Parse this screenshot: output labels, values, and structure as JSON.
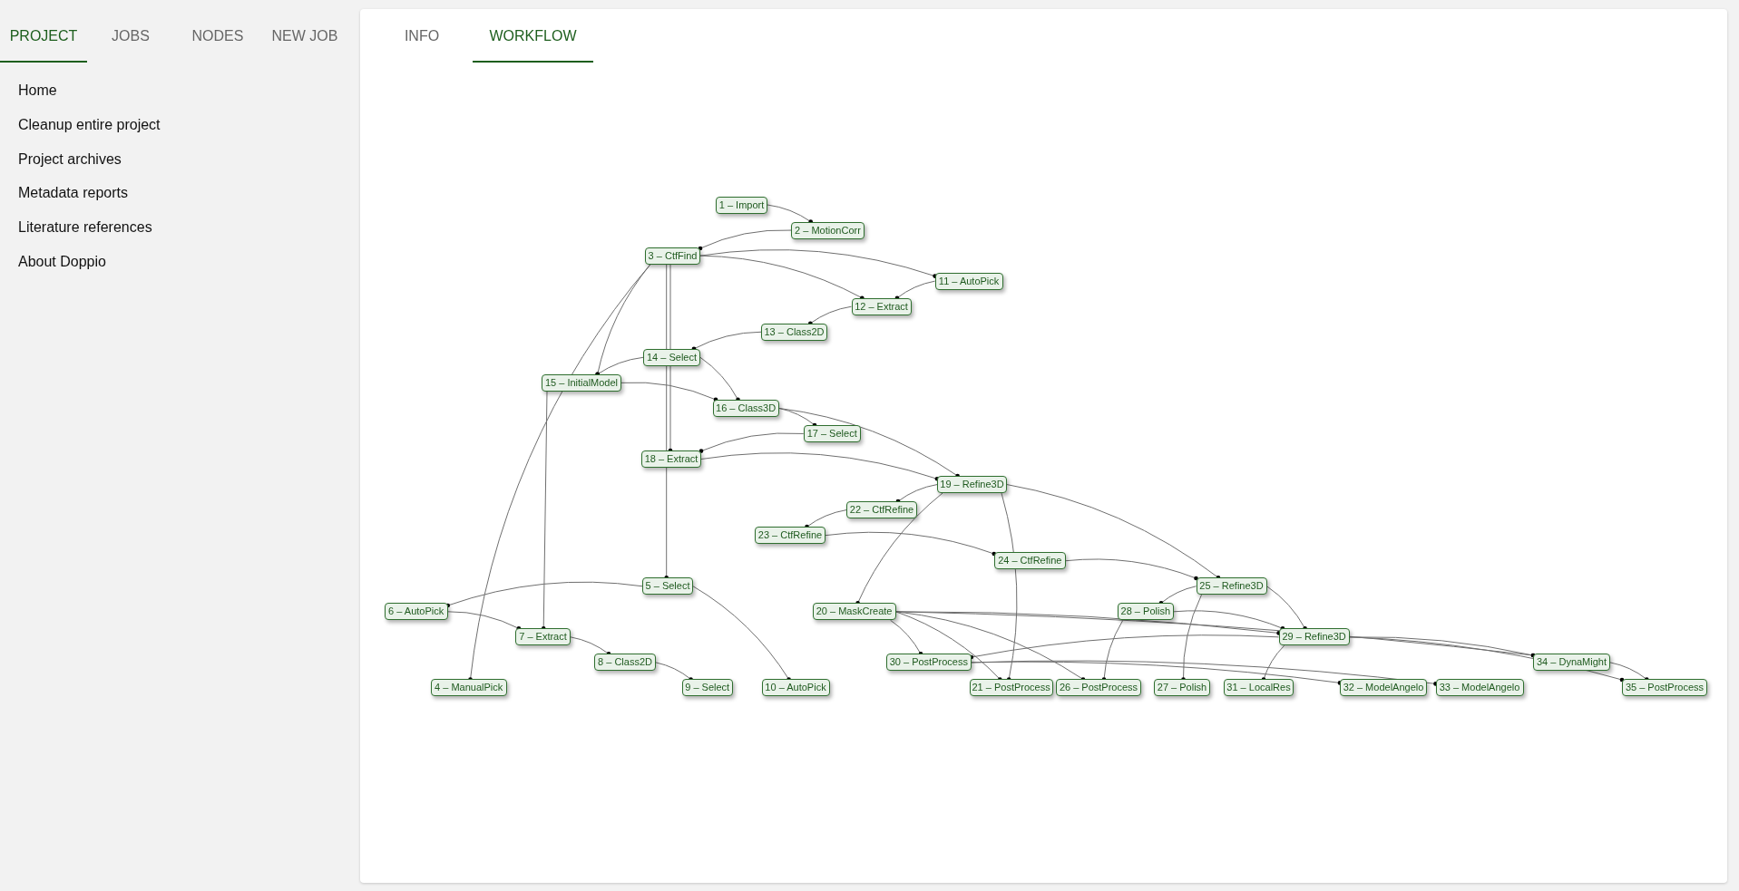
{
  "sidebar": {
    "tabs": [
      {
        "label": "PROJECT",
        "selected": true
      },
      {
        "label": "JOBS",
        "selected": false
      },
      {
        "label": "NODES",
        "selected": false
      },
      {
        "label": "NEW JOB",
        "selected": false
      }
    ],
    "menu": [
      "Home",
      "Cleanup entire project",
      "Project archives",
      "Metadata reports",
      "Literature references",
      "About Doppio"
    ]
  },
  "panel": {
    "tabs": [
      {
        "label": "INFO",
        "selected": false
      },
      {
        "label": "WORKFLOW",
        "selected": true
      }
    ],
    "workflow": {
      "nodes": [
        "1 – Import",
        "2 – MotionCorr",
        "3 – CtfFind",
        "4 – ManualPick",
        "5 – Select",
        "6 – AutoPick",
        "7 – Extract",
        "8 – Class2D",
        "9 – Select",
        "10 – AutoPick",
        "11 – AutoPick",
        "12 – Extract",
        "13 – Class2D",
        "14 – Select",
        "15 – InitialModel",
        "16 – Class3D",
        "17 – Select",
        "18 – Extract",
        "19 – Refine3D",
        "20 – MaskCreate",
        "21 – PostProcess",
        "22 – CtfRefine",
        "23 – CtfRefine",
        "24 – CtfRefine",
        "25 – Refine3D",
        "26 – PostProcess",
        "27 – Polish",
        "28 – Polish",
        "29 – Refine3D",
        "30 – PostProcess",
        "31 – LocalRes",
        "32 – ModelAngelo",
        "33 – ModelAngelo",
        "34 – DynaMight",
        "35 – PostProcess"
      ]
    }
  }
}
